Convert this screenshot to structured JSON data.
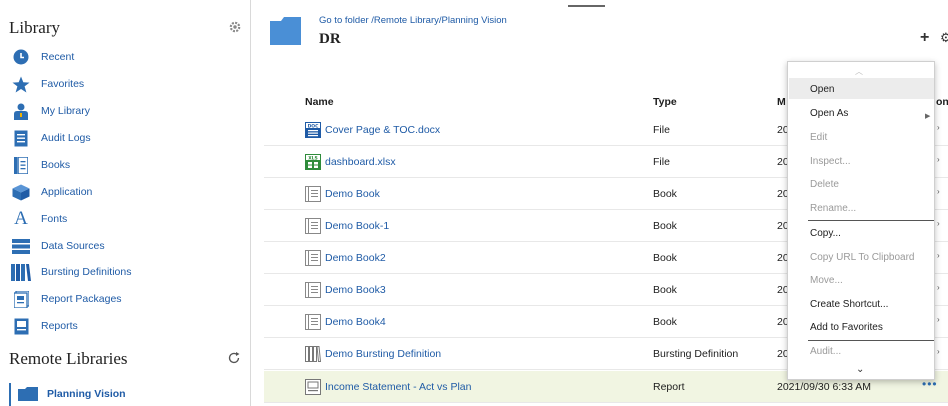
{
  "sidebar": {
    "title": "Library",
    "items": [
      {
        "label": "Recent",
        "icon": "recent-icon"
      },
      {
        "label": "Favorites",
        "icon": "star-icon"
      },
      {
        "label": "My Library",
        "icon": "user-icon"
      },
      {
        "label": "Audit Logs",
        "icon": "audit-logs-icon"
      },
      {
        "label": "Books",
        "icon": "books-icon"
      },
      {
        "label": "Application",
        "icon": "application-cube-icon"
      },
      {
        "label": "Fonts",
        "icon": "font-icon"
      },
      {
        "label": "Data Sources",
        "icon": "database-icon"
      },
      {
        "label": "Bursting Definitions",
        "icon": "bursting-icon"
      },
      {
        "label": "Report Packages",
        "icon": "report-package-icon"
      },
      {
        "label": "Reports",
        "icon": "report-icon"
      }
    ],
    "remote_title": "Remote Libraries",
    "remote_items": [
      {
        "label": "Planning Vision",
        "icon": "folder-icon"
      }
    ]
  },
  "header": {
    "goto": "Go to folder /Remote Library/Planning Vision",
    "title": "DR"
  },
  "table": {
    "columns": {
      "name": "Name",
      "type": "Type",
      "modified": "M",
      "actions": "ons"
    },
    "rows": [
      {
        "name": "Cover Page & TOC.docx",
        "type": "File",
        "modified": "20",
        "icon": "docx-icon"
      },
      {
        "name": "dashboard.xlsx",
        "type": "File",
        "modified": "20",
        "icon": "xlsx-icon"
      },
      {
        "name": "Demo Book",
        "type": "Book",
        "modified": "20",
        "icon": "book-icon"
      },
      {
        "name": "Demo Book-1",
        "type": "Book",
        "modified": "20",
        "icon": "book-icon"
      },
      {
        "name": "Demo Book2",
        "type": "Book",
        "modified": "20",
        "icon": "book-icon"
      },
      {
        "name": "Demo Book3",
        "type": "Book",
        "modified": "20",
        "icon": "book-icon"
      },
      {
        "name": "Demo Book4",
        "type": "Book",
        "modified": "20",
        "icon": "book-icon"
      },
      {
        "name": "Demo Bursting Definition",
        "type": "Bursting Definition",
        "modified": "20",
        "icon": "bursting-icon"
      },
      {
        "name": "Income Statement - Act vs Plan",
        "type": "Report",
        "modified": "2021/09/30 6:33 AM",
        "icon": "report-icon",
        "actions": "•••"
      }
    ]
  },
  "context_menu": {
    "items": [
      {
        "label": "Open",
        "enabled": true,
        "selected": true
      },
      {
        "label": "Open As",
        "enabled": true,
        "submenu": true
      },
      {
        "label": "Edit",
        "enabled": false
      },
      {
        "label": "Inspect...",
        "enabled": false
      },
      {
        "label": "Delete",
        "enabled": false
      },
      {
        "label": "Rename...",
        "enabled": false
      },
      {
        "label": "Copy...",
        "enabled": true
      },
      {
        "label": "Copy URL To Clipboard",
        "enabled": false
      },
      {
        "label": "Move...",
        "enabled": false
      },
      {
        "label": "Create Shortcut...",
        "enabled": true
      },
      {
        "label": "Add to Favorites",
        "enabled": true
      },
      {
        "label": "Audit...",
        "enabled": false
      }
    ]
  },
  "colors": {
    "link": "#1f5ba6",
    "highlight_row": "#f1f5e2",
    "folder": "#4a8fd6"
  }
}
